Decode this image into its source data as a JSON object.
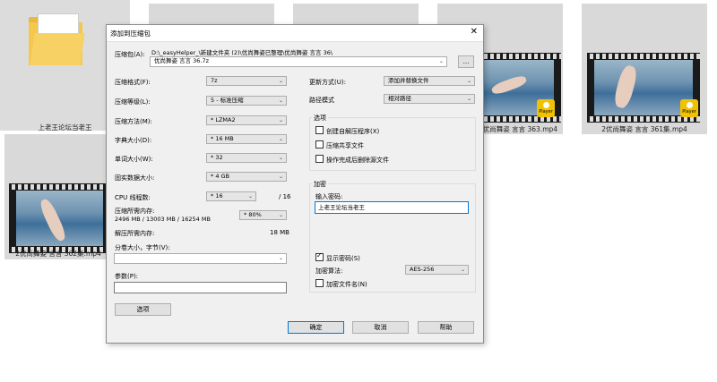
{
  "background_tiles": [
    {
      "caption": "上老王论坛当老王"
    },
    {
      "caption": "2优尚舞姿 言言 363.mp4"
    },
    {
      "caption": "2优尚舞姿 言言 361集.mp4"
    },
    {
      "caption": "2优尚舞姿 言言 362集.mp4"
    }
  ],
  "dialog": {
    "title": "添加到压缩包",
    "close_glyph": "✕",
    "archive_label": "压缩包(A):",
    "archive_path": "D:\\_easyHelper_\\新建文件夹 (2)\\优尚舞姿已整理\\优尚舞姿 言言 36\\",
    "archive_name": "优尚舞姿 言言 36.7z",
    "browse_label": "...",
    "format_label": "压缩格式(F):",
    "format_value": "7z",
    "level_label": "压缩等级(L):",
    "level_value": "5 - 标准压缩",
    "method_label": "压缩方法(M):",
    "method_value": "* LZMA2",
    "dict_label": "字典大小(D):",
    "dict_value": "* 16 MB",
    "word_label": "单词大小(W):",
    "word_value": "* 32",
    "solid_label": "固实数据大小:",
    "solid_value": "* 4 GB",
    "cpu_label": "CPU 线程数:",
    "cpu_value": "* 16",
    "cpu_total": "/ 16",
    "mem_comp_label": "压缩所需内存:",
    "mem_comp_value": "2496 MB / 13003 MB / 16254 MB",
    "mem_percent": "* 80%",
    "mem_decomp_label": "解压所需内存:",
    "mem_decomp_value": "18 MB",
    "split_label": "分卷大小，字节(V):",
    "split_value": "",
    "params_label": "参数(P):",
    "params_value": "",
    "options_button": "选项",
    "update_label": "更新方式(U):",
    "update_value": "添加并替换文件",
    "path_label": "路径模式",
    "path_value": "相对路径",
    "options_group": "选项",
    "opt_sfx": "创建自解压程序(X)",
    "opt_shared": "压缩共享文件",
    "opt_delete": "操作完成后删除源文件",
    "encrypt_group": "加密",
    "password_label": "输入密码:",
    "password_value": "上老王论坛当老王",
    "show_password": "显示密码(S)",
    "enc_method_label": "加密算法:",
    "enc_method_value": "AES-256",
    "encrypt_names": "加密文件名(N)",
    "ok_button": "确定",
    "cancel_button": "取消",
    "help_button": "帮助",
    "dropdown_glyph": "⌄"
  }
}
